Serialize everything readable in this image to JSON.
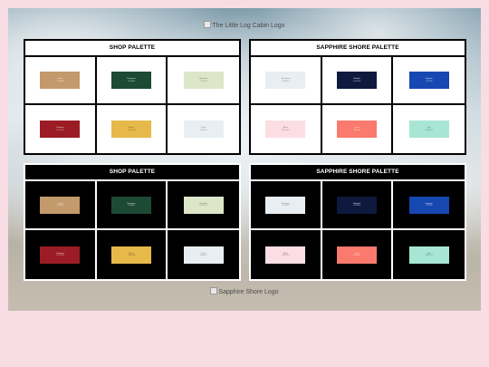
{
  "logos": {
    "top_alt": "The Little Log Cabin Logo",
    "bottom_alt": "Sapphire Shore Logo"
  },
  "palettes": [
    {
      "title": "SHOP PALETTE",
      "swatches": [
        {
          "color": "#c39a6b",
          "name": "Camel",
          "hex": "#C39A6B"
        },
        {
          "color": "#1d4a34",
          "name": "Evergreen",
          "hex": "#1D4A34"
        },
        {
          "color": "#dde6c9",
          "name": "Sage Mist",
          "hex": "#DDE6C9"
        },
        {
          "color": "#9c1c25",
          "name": "Cranberry",
          "hex": "#9C1C25"
        },
        {
          "color": "#e6b94a",
          "name": "Honey",
          "hex": "#E6B94A"
        },
        {
          "color": "#e8eff2",
          "name": "Frost",
          "hex": "#E8EFF2"
        }
      ]
    },
    {
      "title": "SAPPHIRE SHORE PALETTE",
      "swatches": [
        {
          "color": "#e8eef1",
          "name": "Sea Foam",
          "hex": "#E8EEF1"
        },
        {
          "color": "#0d1a3d",
          "name": "Midnight",
          "hex": "#0D1A3D"
        },
        {
          "color": "#1747b0",
          "name": "Sapphire",
          "hex": "#1747B0"
        },
        {
          "color": "#fbdde4",
          "name": "Blush",
          "hex": "#FBDDE4"
        },
        {
          "color": "#fa7a6e",
          "name": "Coral",
          "hex": "#FA7A6E"
        },
        {
          "color": "#a8e6d4",
          "name": "Mint",
          "hex": "#A8E6D4"
        }
      ]
    }
  ],
  "colors": {
    "page_background": "#f9dde4",
    "light_panel": "#ffffff",
    "dark_panel": "#000000"
  }
}
